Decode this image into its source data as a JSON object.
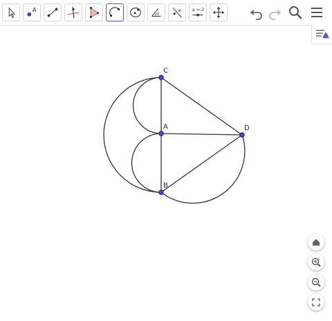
{
  "toolbar": {
    "tools": [
      {
        "name": "move-tool"
      },
      {
        "name": "point-tool",
        "icon_label": "A"
      },
      {
        "name": "segment-tool"
      },
      {
        "name": "perpendicular-line-tool"
      },
      {
        "name": "polygon-tool"
      },
      {
        "name": "semicircle-tool",
        "selected": true
      },
      {
        "name": "circle-tool"
      },
      {
        "name": "angle-tool",
        "icon_label": "α"
      },
      {
        "name": "reflect-tool"
      },
      {
        "name": "slider-tool",
        "icon_label": "a = 2"
      },
      {
        "name": "move-graphics-view-tool"
      }
    ],
    "actions": [
      "undo-icon",
      "redo-icon",
      "search-icon",
      "menu-icon"
    ]
  },
  "construction": {
    "points": [
      {
        "id": "C",
        "label": "C"
      },
      {
        "id": "A",
        "label": "A"
      },
      {
        "id": "D",
        "label": "D"
      },
      {
        "id": "B",
        "label": "B"
      }
    ],
    "segments": [
      "CB",
      "CD",
      "AD",
      "BD"
    ],
    "arcs": [
      "semicircle-CA",
      "semicircle-AB",
      "semicircle-CB",
      "semicircle-BD"
    ]
  },
  "zoom_controls": [
    "home-icon",
    "zoom-in-icon",
    "zoom-out-icon",
    "fullscreen-icon"
  ],
  "colors": {
    "accent": "#6557d2",
    "point_fill": "#4a4ad8",
    "point_stroke": "#1a1a8a",
    "label": "#1a1aa6",
    "line": "#333333"
  }
}
